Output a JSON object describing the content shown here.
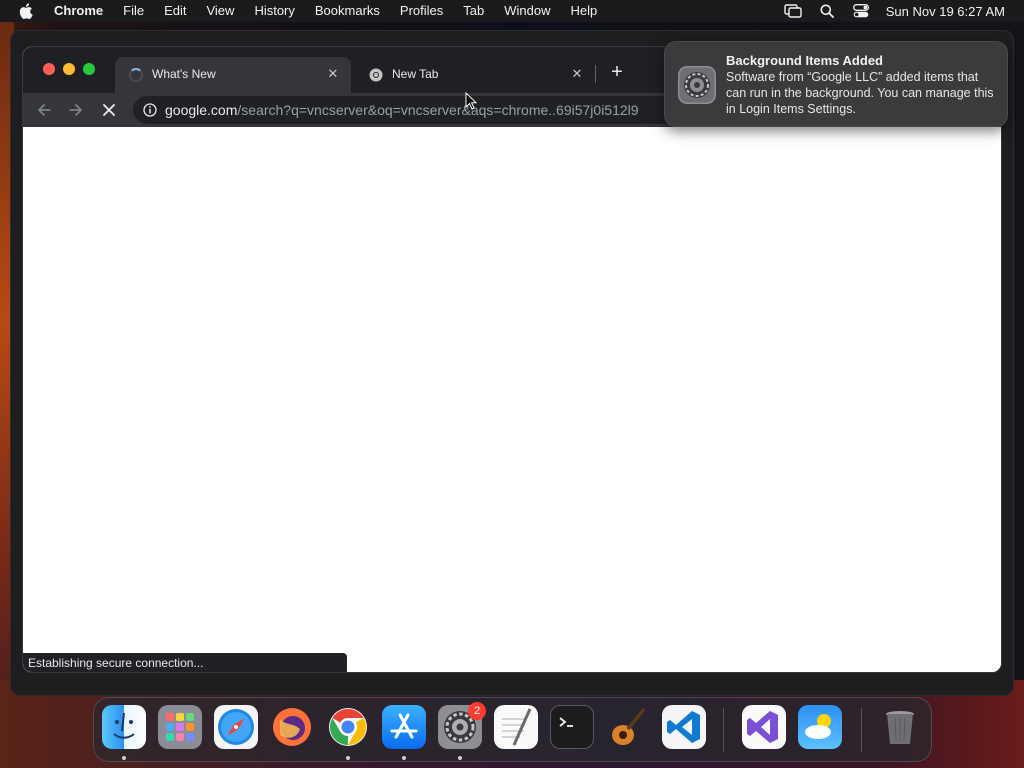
{
  "menubar": {
    "app_name": "Chrome",
    "items": [
      "File",
      "Edit",
      "View",
      "History",
      "Bookmarks",
      "Profiles",
      "Tab",
      "Window",
      "Help"
    ],
    "clock": "Sun Nov 19  6:27 AM",
    "status_icons": [
      "screen-mirroring-icon",
      "spotlight-search-icon",
      "control-center-icon"
    ]
  },
  "browser": {
    "tabs": [
      {
        "title": "What's New",
        "state": "loading"
      },
      {
        "title": "New Tab",
        "state": "idle"
      }
    ],
    "address_bar": {
      "host": "google.com",
      "path": "/search?q=vncserver&oq=vncserver&aqs=chrome..69i57j0i512l9"
    },
    "status_text": "Establishing secure connection..."
  },
  "notification": {
    "title": "Background Items Added",
    "body": "Software from “Google LLC” added items that can run in the background. You can manage this in Login Items Settings.",
    "icon": "system-settings-icon"
  },
  "dock": {
    "apps": [
      {
        "name": "Finder",
        "running": true
      },
      {
        "name": "Launchpad",
        "running": false
      },
      {
        "name": "Safari",
        "running": false
      },
      {
        "name": "Firefox",
        "running": false
      },
      {
        "name": "Google Chrome",
        "running": true
      },
      {
        "name": "App Store",
        "running": true
      },
      {
        "name": "System Settings",
        "running": true,
        "badge": "2"
      },
      {
        "name": "TextEdit",
        "running": false
      },
      {
        "name": "Terminal",
        "running": false
      },
      {
        "name": "GarageBand",
        "running": false
      },
      {
        "name": "Visual Studio Code",
        "running": false
      },
      {
        "name": "Visual Studio",
        "running": false
      },
      {
        "name": "Weather",
        "running": false
      },
      {
        "name": "Trash",
        "running": false
      }
    ]
  }
}
